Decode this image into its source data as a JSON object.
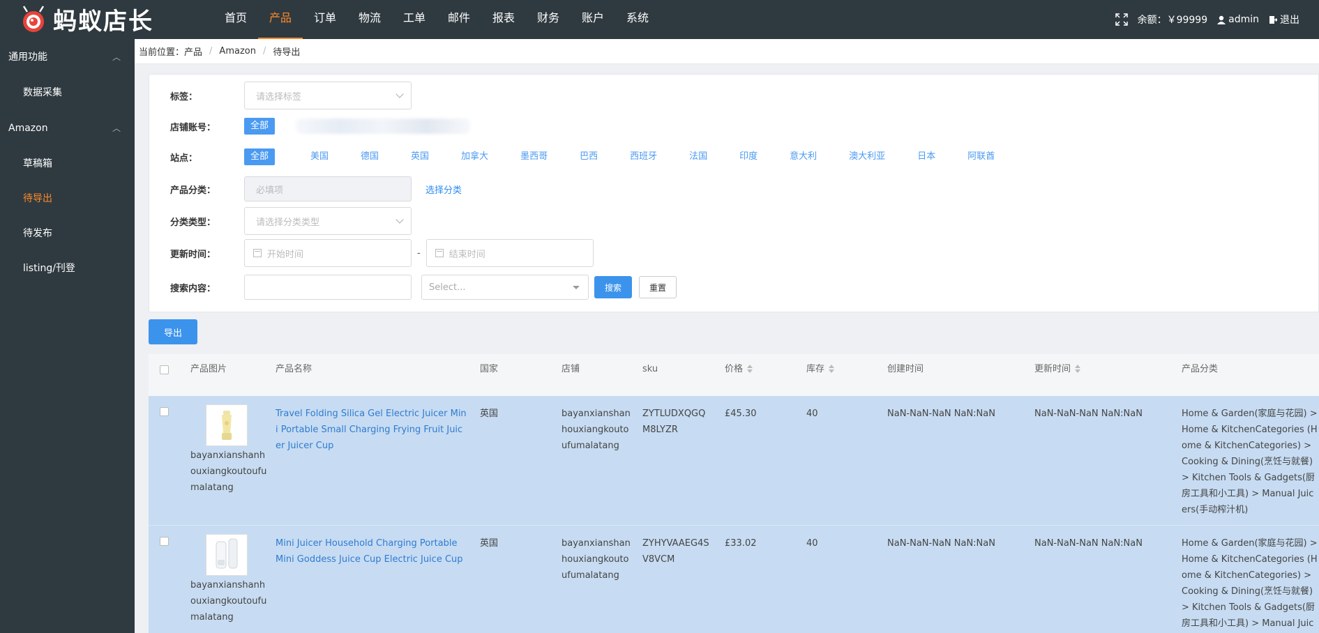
{
  "logo": {
    "text": "蚂蚁店长"
  },
  "nav": {
    "items": [
      "首页",
      "产品",
      "订单",
      "物流",
      "工单",
      "邮件",
      "报表",
      "财务",
      "账户",
      "系统"
    ],
    "active_index": 1
  },
  "top_right": {
    "balance": "余额：￥99999",
    "user": "admin",
    "logout": "退出"
  },
  "sidebar": {
    "groups": [
      {
        "label": "通用功能",
        "items": [
          "数据采集"
        ]
      },
      {
        "label": "Amazon",
        "items": [
          "草稿箱",
          "待导出",
          "待发布",
          "listing/刊登"
        ]
      }
    ],
    "active_item": "待导出"
  },
  "breadcrumb": {
    "prefix": "当前位置：",
    "items": [
      "产品",
      "Amazon",
      "待导出"
    ]
  },
  "filters": {
    "tag_label": "标签：",
    "tag_placeholder": "请选择标签",
    "shop_label": "店铺账号：",
    "shop_all": "全部",
    "site_label": "站点：",
    "sites": [
      "全部",
      "美国",
      "德国",
      "英国",
      "加拿大",
      "墨西哥",
      "巴西",
      "西班牙",
      "法国",
      "印度",
      "意大利",
      "澳大利亚",
      "日本",
      "阿联酋"
    ],
    "category_label": "产品分类：",
    "category_placeholder": "必填项",
    "category_link": "选择分类",
    "cat_type_label": "分类类型：",
    "cat_type_placeholder": "请选择分类类型",
    "time_label": "更新时间：",
    "start_placeholder": "开始时间",
    "end_placeholder": "结束时间",
    "time_sep": "-",
    "search_label": "搜索内容：",
    "search_select_placeholder": "Select...",
    "search_button": "搜索",
    "reset_button": "重置"
  },
  "export_button": "导出",
  "table": {
    "columns": [
      "产品图片",
      "产品名称",
      "国家",
      "店铺",
      "sku",
      "价格",
      "库存",
      "创建时间",
      "更新时间",
      "产品分类"
    ],
    "rows": [
      {
        "image_caption": "bayanxianshanhouxiangkoutoufumalatang",
        "name": "Travel Folding Silica Gel Electric Juicer Mini Portable Small Charging Frying Fruit Juicer Juicer Cup",
        "country": "英国",
        "shop": "bayanxianshanhouxiangkoutoufumalatang",
        "sku": "ZYTLUDXQGQM8LYZR",
        "price": "£45.30",
        "stock": "40",
        "created": "NaN-NaN-NaN NaN:NaN",
        "updated": "NaN-NaN-NaN NaN:NaN",
        "category": "Home & Garden(家庭与花园) > Home & KitchenCategories (Home & KitchenCategories) > Cooking & Dining(烹饪与就餐) > Kitchen Tools & Gadgets(厨房工具和小工具) > Manual Juicers(手动榨汁机)"
      },
      {
        "image_caption": "bayanxianshanhouxiangkoutoufumalatang",
        "name": "Mini Juicer Household Charging Portable Mini Goddess Juice Cup Electric Juice Cup",
        "country": "英国",
        "shop": "bayanxianshanhouxiangkoutoufumalatang",
        "sku": "ZYHYVAAEG4SV8VCM",
        "price": "£33.02",
        "stock": "40",
        "created": "NaN-NaN-NaN NaN:NaN",
        "updated": "NaN-NaN-NaN NaN:NaN",
        "category": "Home & Garden(家庭与花园) > Home & KitchenCategories (Home & KitchenCategories) > Cooking & Dining(烹饪与就餐) > Kitchen Tools & Gadgets(厨房工具和小工具) > Manual Juicers(手动榨汁机)"
      }
    ]
  },
  "colors": {
    "topbar": "#2f3a40",
    "accent": "#ff8a2a",
    "primary": "#3c93ec",
    "row_selected": "#c7dcf2"
  }
}
